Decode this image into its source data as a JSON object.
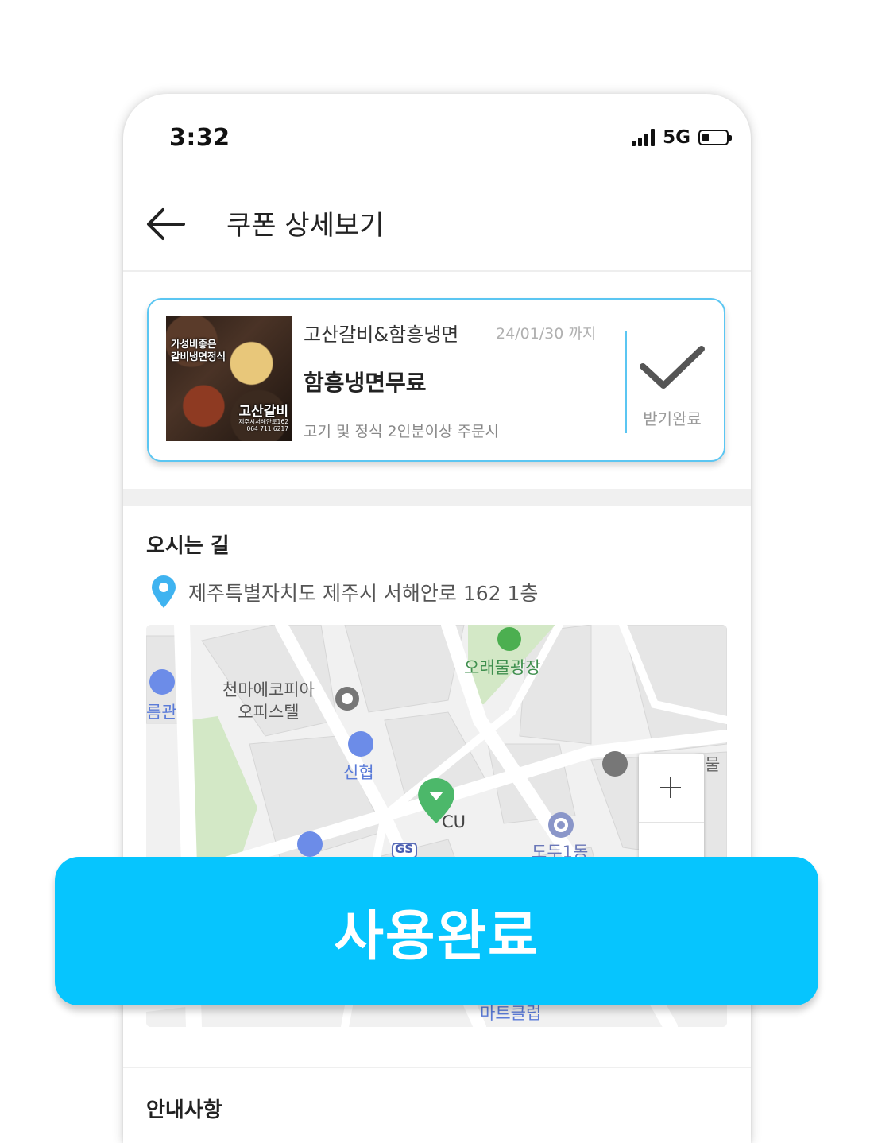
{
  "status_bar": {
    "time": "3:32",
    "network": "5G"
  },
  "header": {
    "title": "쿠폰 상세보기"
  },
  "coupon": {
    "image": {
      "line1": "가성비좋은",
      "line2": "갈비냉면정식",
      "store": "고산갈비",
      "address_line": "제주시서해안로162",
      "phone": "064 711 6217"
    },
    "store_name": "고산갈비&함흥냉면",
    "expiry": "24/01/30 까지",
    "benefit": "함흥냉면무료",
    "condition": "고기 및 정식 2인분이상 주문시",
    "status_label": "받기완료",
    "accent_color": "#5bc6f2"
  },
  "directions": {
    "title": "오시는 길",
    "address": "제주특별자치도 제주시 서해안로 162 1층",
    "map_labels": {
      "plaza": "오래물광장",
      "building_line1": "천마에코피아",
      "building_line2": "오피스텔",
      "bank": "신협",
      "store": "CU",
      "hotel_partial": "름관",
      "gas": "GS",
      "district": "도두1동",
      "right_partial": "물",
      "mart": "마트클럽"
    }
  },
  "guide": {
    "title": "안내사항"
  },
  "action": {
    "label": "사용완료",
    "color": "#06c5fe"
  }
}
